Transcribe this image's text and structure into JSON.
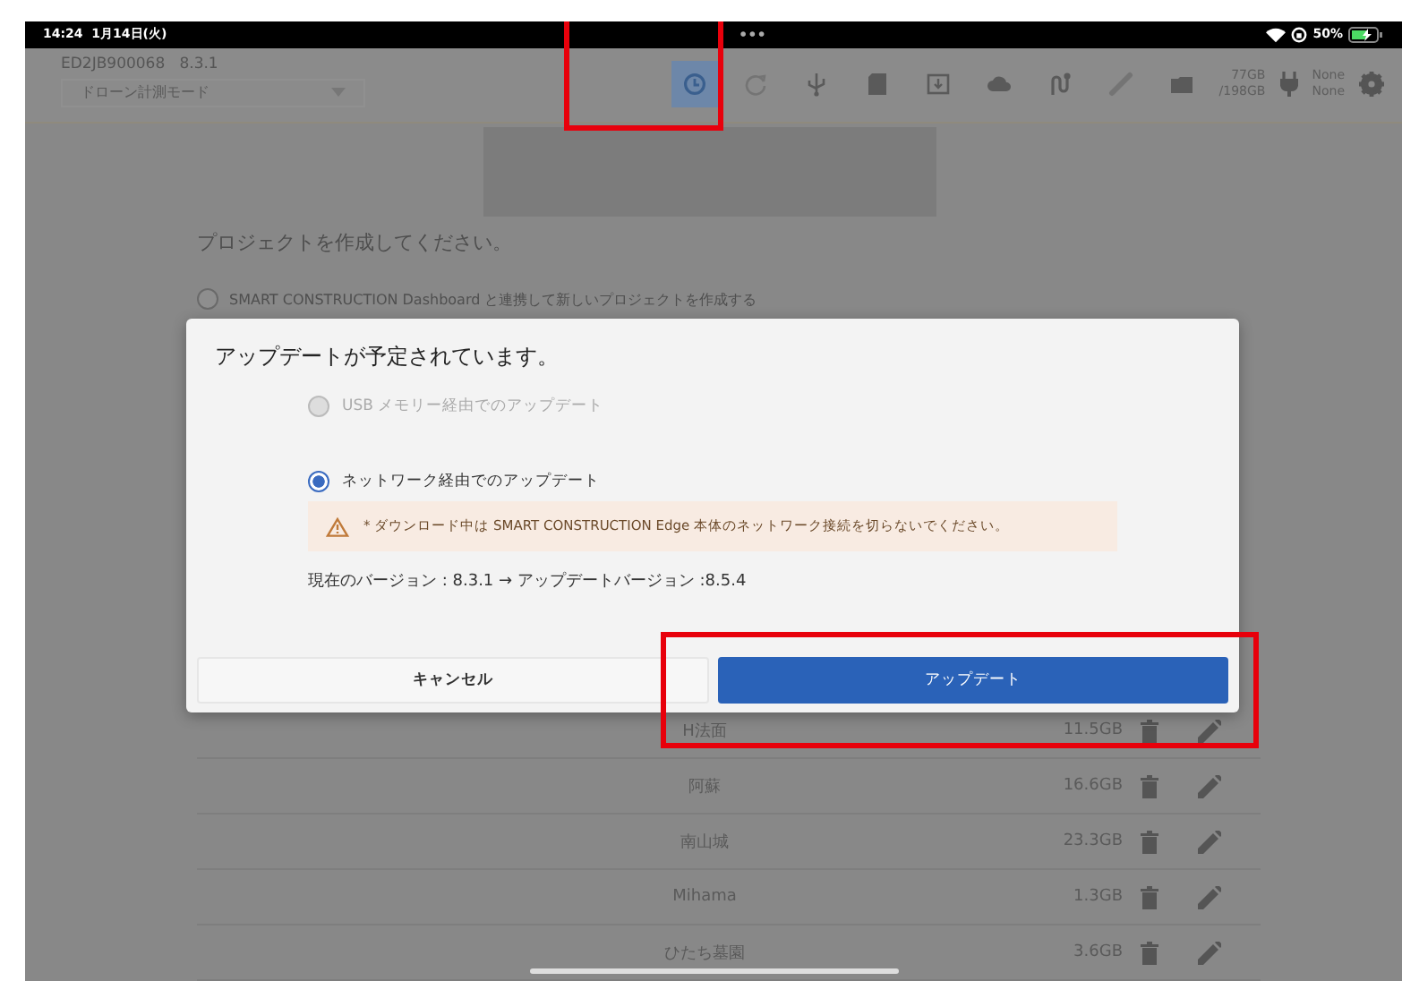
{
  "status_bar": {
    "time": "14:24",
    "date": "1月14日(火)",
    "dots": "•••",
    "battery": "50%"
  },
  "header": {
    "device_id": "ED2JB900068",
    "version": "8.3.1",
    "mode_select": "ドローン計測モード",
    "toolbar": [
      {
        "selected": true,
        "disabled": false
      },
      {
        "selected": false,
        "disabled": true
      },
      {
        "selected": false,
        "disabled": false
      },
      {
        "selected": false,
        "disabled": false
      },
      {
        "selected": false,
        "disabled": false
      },
      {
        "selected": false,
        "disabled": false
      },
      {
        "selected": false,
        "disabled": false
      },
      {
        "selected": false,
        "disabled": true
      },
      {
        "selected": false,
        "disabled": false
      }
    ],
    "storage": {
      "used": "77GB",
      "total": "/198GB"
    },
    "power": {
      "line_1": "None",
      "line_2": "None"
    }
  },
  "page": {
    "prompt": "プロジェクトを作成してください。",
    "options": [
      {
        "label": "SMART CONSTRUCTION Dashboard と連携して新しいプロジェクトを作成する",
        "selected": false
      }
    ],
    "projects": [
      {
        "name": "H法面",
        "size": "11.5GB"
      },
      {
        "name": "阿蘇",
        "size": "16.6GB"
      },
      {
        "name": "南山城",
        "size": "23.3GB"
      },
      {
        "name": "Mihama",
        "size": "1.3GB"
      },
      {
        "name": "ひたち墓園",
        "size": "3.6GB"
      }
    ]
  },
  "dialog": {
    "title": "アップデートが予定されています。",
    "options": [
      {
        "label": "USB メモリー経由でのアップデート",
        "selected": false,
        "disabled": true
      },
      {
        "label": "ネットワーク経由でのアップデート",
        "selected": true,
        "disabled": false
      }
    ],
    "warning": "* ダウンロード中は SMART CONSTRUCTION Edge 本体のネットワーク接続を切らないでください。",
    "version_text": "現在のバージョン : 8.3.1 → アップデートバージョン :8.5.4",
    "cancel": "キャンセル",
    "confirm": "アップデート"
  }
}
